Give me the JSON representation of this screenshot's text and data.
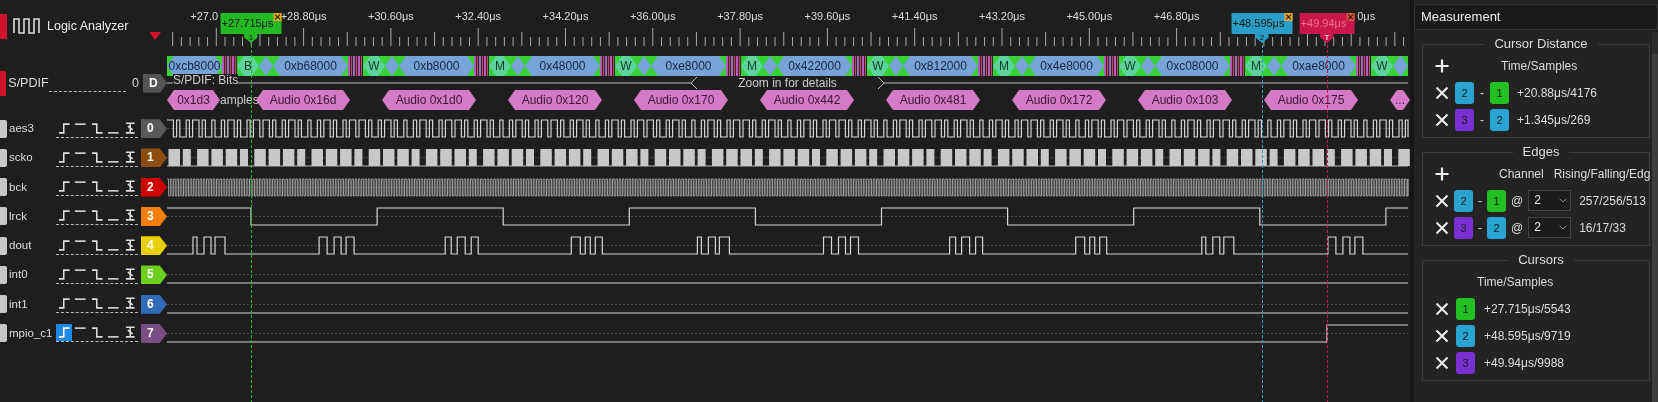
{
  "app": {
    "title": "Logic Analyzer"
  },
  "ruler": {
    "ticks": [
      "+27.0",
      "+28.80μs",
      "+30.60μs",
      "+32.40μs",
      "+34.20μs",
      "+36.00μs",
      "+37.80μs",
      "+39.60μs",
      "+41.40μs",
      "+43.20μs",
      "+45.00μs",
      "+46.80μs",
      "0μs"
    ],
    "cursors": [
      {
        "label": "+27.715μs",
        "marker": "1",
        "color": "#25b825",
        "dimmed": false
      },
      {
        "label": "+48.595μs",
        "marker": "2",
        "color": "#2a9ec6",
        "dimmed": false
      },
      {
        "label": "+49.94μs",
        "marker": "T",
        "color": "#c8174c",
        "dimmed": true
      }
    ]
  },
  "decoder": {
    "name": "S/PDIF",
    "index": "0",
    "badge": "D",
    "frames": [
      {
        "value": "0xcb8000"
      },
      {
        "marker": "B",
        "value": "0xb68000"
      },
      {
        "marker": "W",
        "value": "0xb8000"
      },
      {
        "marker": "M",
        "value": "0x48000"
      },
      {
        "marker": "W",
        "value": "0xe8000"
      },
      {
        "marker": "M",
        "value": "0x422000"
      },
      {
        "marker": "W",
        "value": "0x812000"
      },
      {
        "marker": "M",
        "value": "0x4e8000"
      },
      {
        "marker": "W",
        "value": "0xc08000"
      },
      {
        "marker": "M",
        "value": "0xae8000"
      },
      {
        "marker": "W"
      }
    ],
    "bits_label": "S/PDIF: Bits",
    "bits_note": "Zoom in for details",
    "samples_label": "amples",
    "samples": [
      "0x1d3",
      "Audio 0x16d",
      "Audio 0x1d0",
      "Audio 0x120",
      "Audio 0x170",
      "Audio 0x442",
      "Audio 0x481",
      "Audio 0x172",
      "Audio 0x103",
      "Audio 0x175",
      "..."
    ]
  },
  "channels": [
    {
      "name": "aes3",
      "number": "0",
      "color": "#5a5a5a",
      "kind": "biphase",
      "triggers": [
        {
          "kind": "rising",
          "selected": false
        },
        {
          "kind": "high",
          "selected": false
        },
        {
          "kind": "falling",
          "selected": false
        },
        {
          "kind": "low",
          "selected": false
        },
        {
          "kind": "either",
          "selected": false
        }
      ]
    },
    {
      "name": "scko",
      "number": "1",
      "color": "#8b4c0c",
      "kind": "burst",
      "triggers": [
        {
          "kind": "rising",
          "selected": false
        },
        {
          "kind": "high",
          "selected": false
        },
        {
          "kind": "falling",
          "selected": false
        },
        {
          "kind": "low",
          "selected": false
        },
        {
          "kind": "either",
          "selected": false
        }
      ]
    },
    {
      "name": "bck",
      "number": "2",
      "color": "#d00000",
      "kind": "clock",
      "triggers": [
        {
          "kind": "rising",
          "selected": false
        },
        {
          "kind": "high",
          "selected": false
        },
        {
          "kind": "falling",
          "selected": false
        },
        {
          "kind": "low",
          "selected": false
        },
        {
          "kind": "either",
          "selected": false
        }
      ]
    },
    {
      "name": "lrck",
      "number": "3",
      "color": "#f57f0c",
      "kind": "alternating",
      "triggers": [
        {
          "kind": "rising",
          "selected": false
        },
        {
          "kind": "high",
          "selected": false
        },
        {
          "kind": "falling",
          "selected": false
        },
        {
          "kind": "low",
          "selected": false
        },
        {
          "kind": "either",
          "selected": false
        }
      ]
    },
    {
      "name": "dout",
      "number": "4",
      "color": "#e6d000",
      "kind": "packets",
      "triggers": [
        {
          "kind": "rising",
          "selected": false
        },
        {
          "kind": "high",
          "selected": false
        },
        {
          "kind": "falling",
          "selected": false
        },
        {
          "kind": "low",
          "selected": false
        },
        {
          "kind": "either",
          "selected": false
        }
      ]
    },
    {
      "name": "int0",
      "number": "5",
      "color": "#6ccf1e",
      "kind": "low",
      "triggers": [
        {
          "kind": "rising",
          "selected": false
        },
        {
          "kind": "high",
          "selected": false
        },
        {
          "kind": "falling",
          "selected": false
        },
        {
          "kind": "low",
          "selected": false
        },
        {
          "kind": "either",
          "selected": false
        }
      ]
    },
    {
      "name": "int1",
      "number": "6",
      "color": "#2f6bb6",
      "kind": "low",
      "triggers": [
        {
          "kind": "rising",
          "selected": false
        },
        {
          "kind": "high",
          "selected": false
        },
        {
          "kind": "falling",
          "selected": false
        },
        {
          "kind": "low",
          "selected": false
        },
        {
          "kind": "either",
          "selected": false
        }
      ]
    },
    {
      "name": "mpio_c1",
      "number": "7",
      "color": "#7b4d86",
      "kind": "step",
      "triggers": [
        {
          "kind": "rising",
          "selected": true
        },
        {
          "kind": "high",
          "selected": false
        },
        {
          "kind": "falling",
          "selected": false
        },
        {
          "kind": "low",
          "selected": false
        },
        {
          "kind": "either",
          "selected": false
        }
      ]
    }
  ],
  "measurement": {
    "title": "Measurement",
    "cursor_distance": {
      "title": "Cursor Distance",
      "column": "Time/Samples",
      "rows": [
        {
          "from": {
            "label": "2",
            "color": "#29a3cf"
          },
          "operator": "-",
          "to": {
            "label": "1",
            "color": "#22c022"
          },
          "value": "+20.88μs/4176"
        },
        {
          "from": {
            "label": "3",
            "color": "#7a2fd0"
          },
          "operator": "-",
          "to": {
            "label": "2",
            "color": "#29a3cf"
          },
          "value": "+1.345μs/269"
        }
      ]
    },
    "edges": {
      "title": "Edges",
      "columns": [
        "Channel",
        "Rising/Falling/Edg"
      ],
      "rows": [
        {
          "from": {
            "label": "2",
            "color": "#29a3cf"
          },
          "operator": "-",
          "to": {
            "label": "1",
            "color": "#22c022"
          },
          "at": "@",
          "channel": "2",
          "value": "257/256/513"
        },
        {
          "from": {
            "label": "3",
            "color": "#7a2fd0"
          },
          "operator": "-",
          "to": {
            "label": "2",
            "color": "#29a3cf"
          },
          "at": "@",
          "channel": "2",
          "value": "16/17/33"
        }
      ]
    },
    "cursors": {
      "title": "Cursors",
      "column": "Time/Samples",
      "rows": [
        {
          "badge": {
            "label": "1",
            "color": "#22c022"
          },
          "value": "+27.715μs/5543"
        },
        {
          "badge": {
            "label": "2",
            "color": "#29a3cf"
          },
          "value": "+48.595μs/9719"
        },
        {
          "badge": {
            "label": "3",
            "color": "#7a2fd0"
          },
          "value": "+49.94μs/9988"
        }
      ]
    }
  }
}
